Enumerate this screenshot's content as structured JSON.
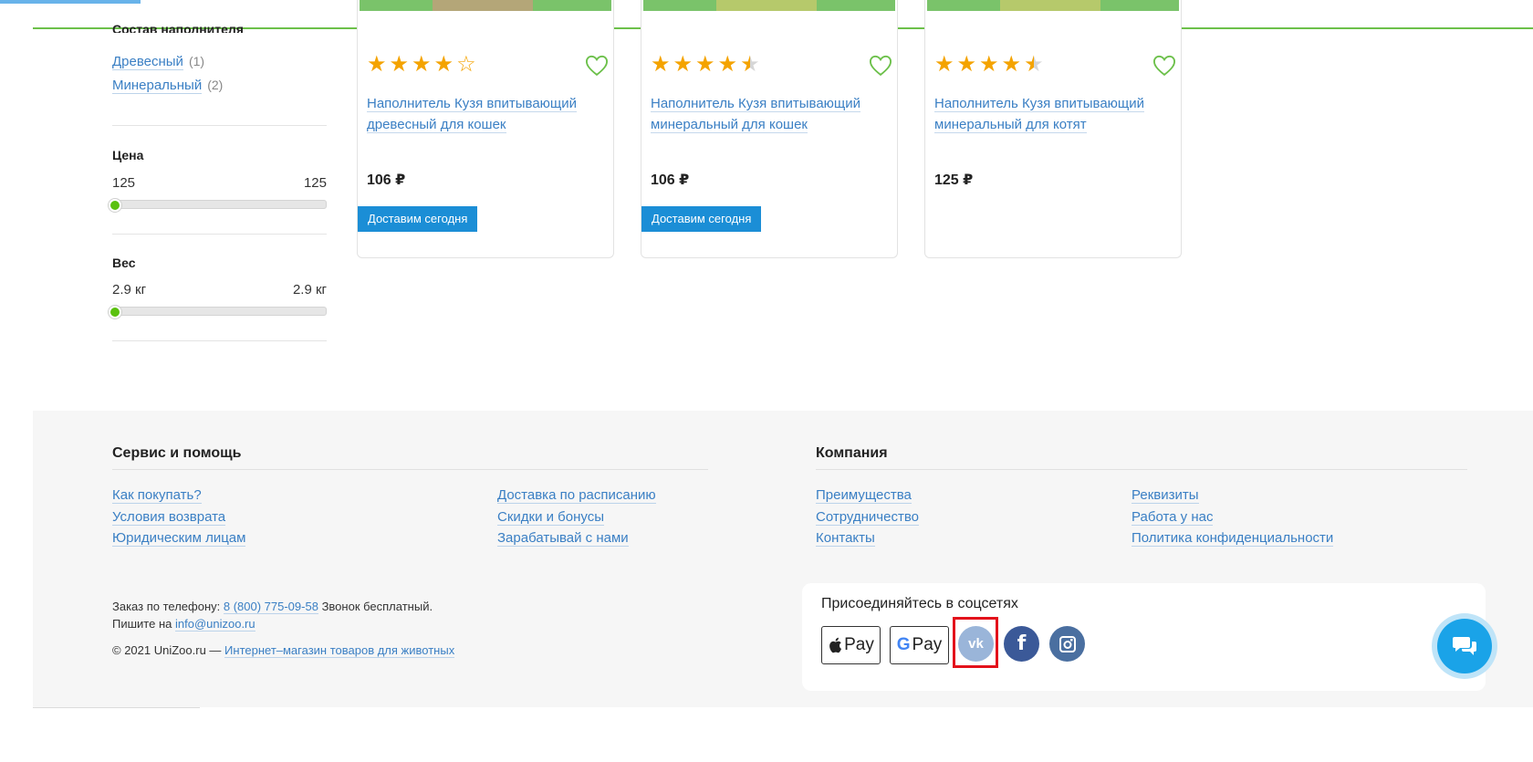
{
  "sidebar": {
    "section_title_cut": "Состав наполнителя",
    "filler_options": [
      {
        "label": "Древесный",
        "count": "(1)"
      },
      {
        "label": "Минеральный",
        "count": "(2)"
      }
    ],
    "price_filter": {
      "label": "Цена",
      "min": "125",
      "max": "125",
      "level": 0
    },
    "weight_filter": {
      "label": "Вес",
      "min": "2.9 кг",
      "max": "2.9 кг",
      "level": 0
    }
  },
  "products": [
    {
      "rating": 4,
      "rating_stars": "★★★★☆",
      "title": "Наполнитель Кузя впитывающий древесный для кошек",
      "price": "106 ₽",
      "delivery_label": "Доставим сегодня"
    },
    {
      "rating": 4.5,
      "rating_stars": "★★★★½",
      "title": "Наполнитель Кузя впитывающий минеральный для кошек",
      "price": "106 ₽",
      "delivery_label": "Доставим сегодня"
    },
    {
      "rating": 4.5,
      "rating_stars": "★★★★½",
      "title": "Наполнитель Кузя впитывающий минеральный для котят",
      "price": "125 ₽",
      "delivery_label": ""
    }
  ],
  "footer": {
    "service": {
      "title": "Сервис и помощь",
      "col1": [
        "Как покупать?",
        "Условия возврата",
        "Юридическим лицам"
      ],
      "col2": [
        "Доставка по расписанию",
        "Скидки и бонусы",
        "Зарабатывай с нами"
      ]
    },
    "company": {
      "title": "Компания",
      "col1": [
        "Преимущества",
        "Сотрудничество",
        "Контакты"
      ],
      "col2": [
        "Реквизиты",
        "Работа у нас",
        "Политика конфиденциальности"
      ]
    },
    "contacts": {
      "phone_prefix": "Заказ по телефону:",
      "phone": "8 (800) 775-09-58",
      "phone_suffix": "Звонок бесплатный.",
      "email_prefix": "Пишите на",
      "email": "info@unizoo.ru",
      "copyright": "© 2021 UniZoo.ru —",
      "copyright_link": "Интернет–магазин товаров для животных"
    },
    "social": {
      "title": "Присоединяйтесь в соцсетях",
      "apple_pay": "Pay",
      "google_pay": "Pay",
      "vk_label": "vk",
      "facebook_label": "f"
    }
  },
  "colors": {
    "accent_green": "#6cc04a",
    "link_blue": "#3a7fc4",
    "delivery_blue": "#1b8ed6",
    "star_orange": "#f4a300",
    "vk_blue": "#9ab5d9",
    "facebook_blue": "#3b5998",
    "instagram_blue": "#4a6fa0",
    "highlight_red": "#e3121b",
    "chat_blue": "#1aa3e8"
  },
  "icons": {
    "heart": "heart-outline-icon",
    "apple": "apple-icon",
    "google": "google-g-icon",
    "vk": "vk-icon",
    "facebook": "facebook-icon",
    "instagram": "instagram-icon",
    "chat": "chat-bubbles-icon"
  }
}
